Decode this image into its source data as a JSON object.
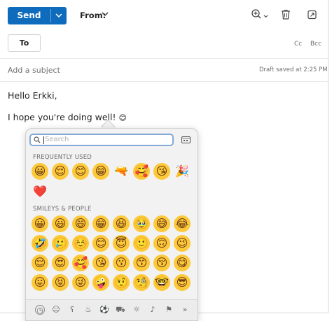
{
  "toolbar": {
    "send_label": "Send",
    "from_label": "From:"
  },
  "recipients": {
    "to_label": "To",
    "cc_label": "Cc",
    "bcc_label": "Bcc"
  },
  "subject": {
    "placeholder": "Add a subject",
    "draft_status": "Draft saved at 2:25 PM"
  },
  "body": {
    "greeting": "Hello Erkki,",
    "line2": "I hope you're doing well!",
    "line2_emoji": "😊"
  },
  "emoji_picker": {
    "search_placeholder": "Search",
    "frequently_used_label": "FREQUENTLY USED",
    "frequently_used": [
      "😀",
      "😌",
      "😊",
      "😁",
      "🔫",
      "🥰",
      "😘",
      "🎉",
      "❤️"
    ],
    "smileys_label": "SMILEYS & PEOPLE",
    "smileys": [
      "😀",
      "😃",
      "😄",
      "😁",
      "😆",
      "🥹",
      "😅",
      "😂",
      "🤣",
      "🥲",
      "☺️",
      "😊",
      "😇",
      "🙂",
      "🙃",
      "😉",
      "😌",
      "😍",
      "🥰",
      "😘",
      "😗",
      "😙",
      "😚",
      "😋",
      "😛",
      "😝",
      "😜",
      "🤪",
      "🤨",
      "🧐",
      "🤓",
      "😎"
    ],
    "categories": [
      "clock-icon",
      "smiley-icon",
      "bear-icon",
      "food-icon",
      "ball-icon",
      "car-icon",
      "bulb-icon",
      "symbols-icon",
      "flag-icon",
      "more-icon"
    ]
  }
}
